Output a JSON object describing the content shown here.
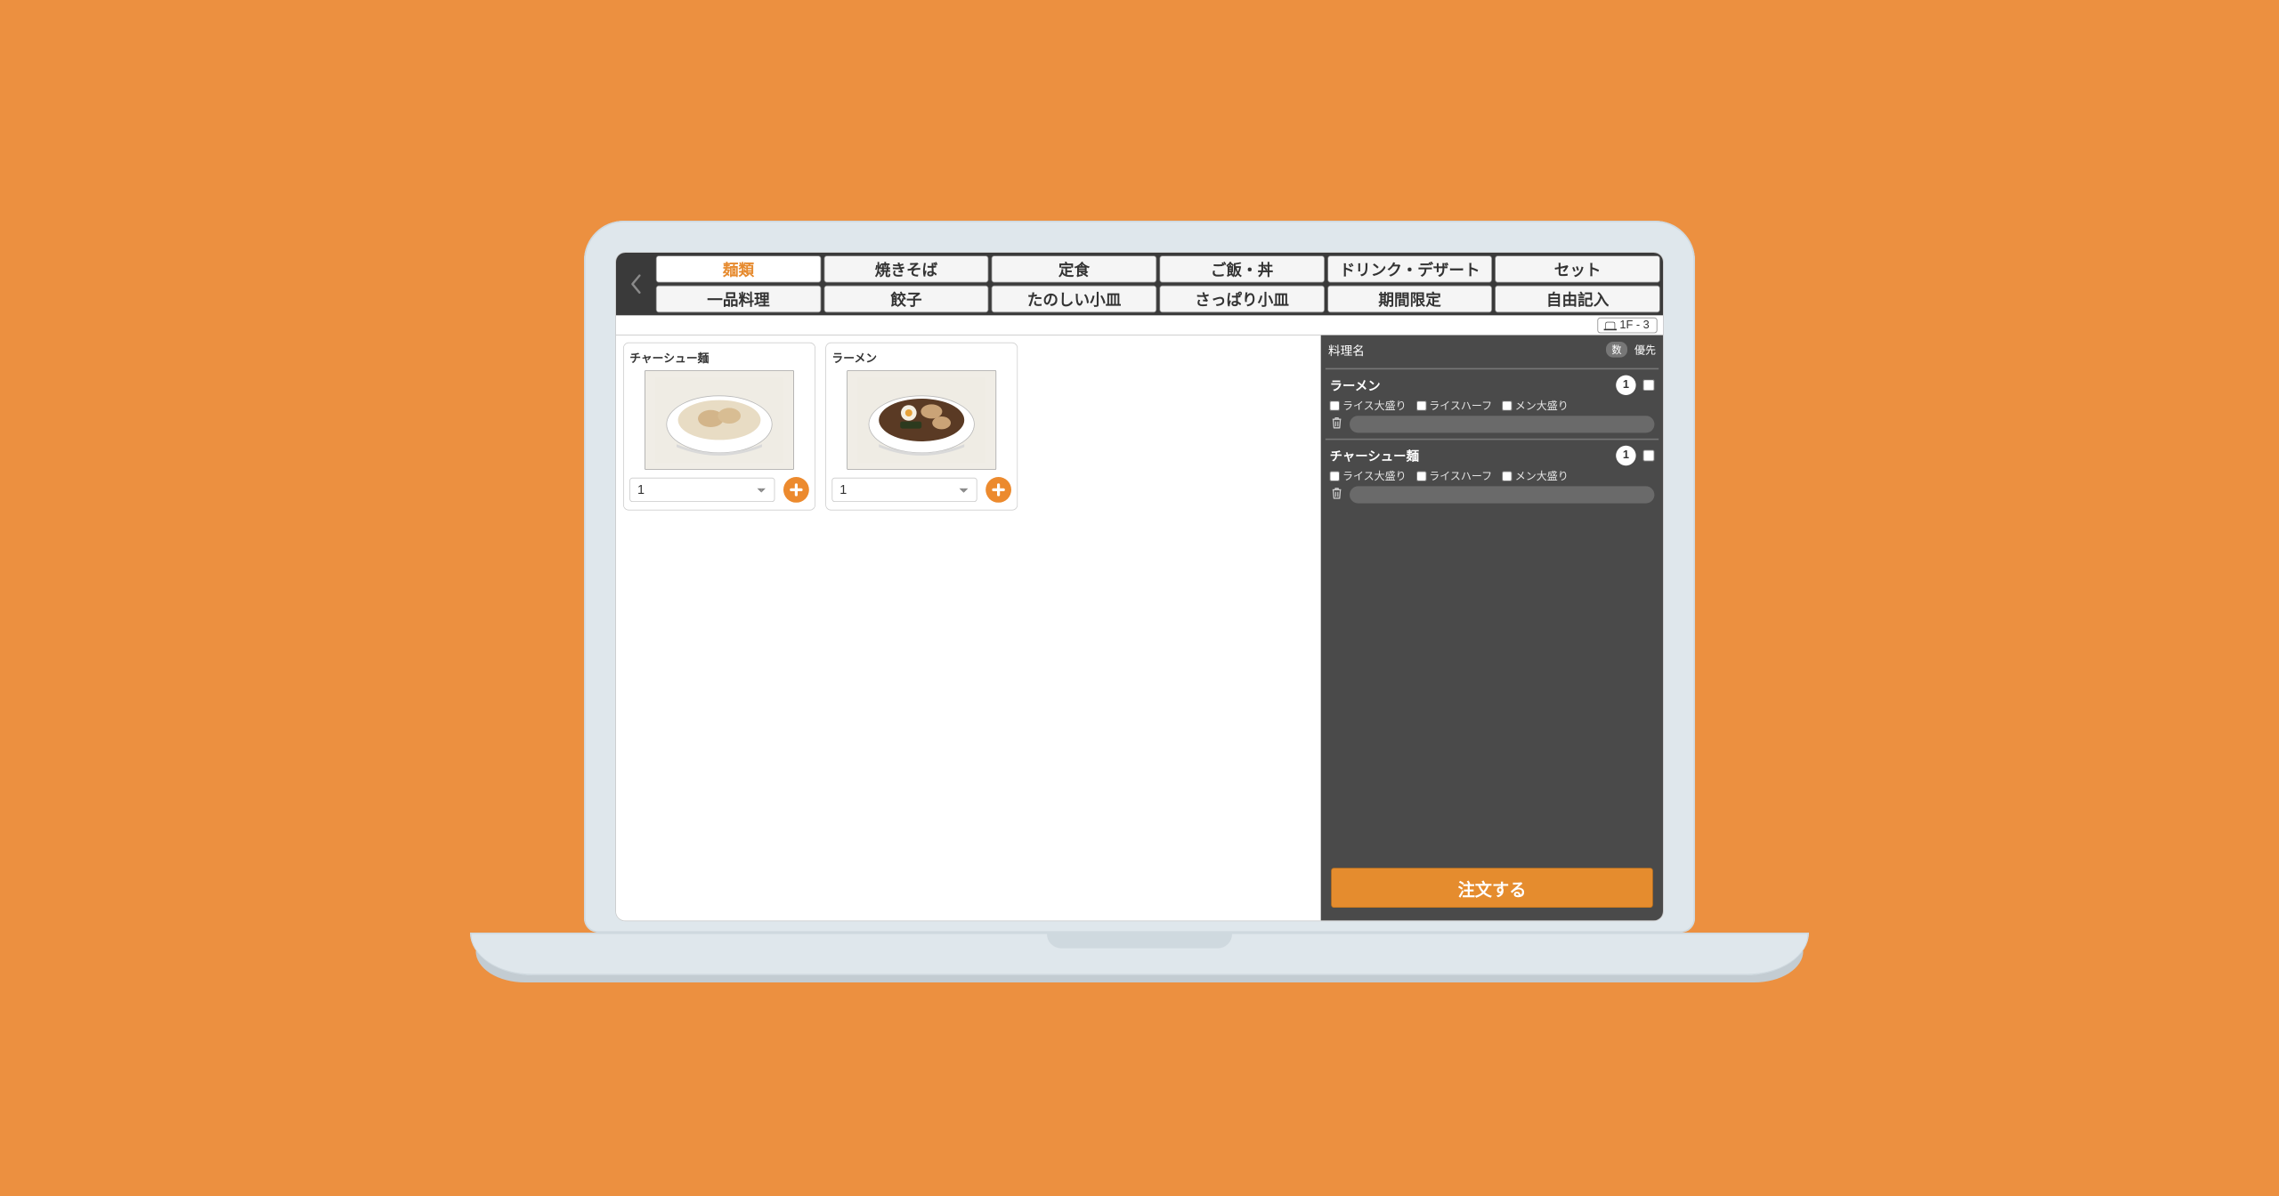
{
  "accent": "#ec8a2e",
  "table_label": "1F - 3",
  "tabs_row1": [
    "麺類",
    "焼きそば",
    "定食",
    "ご飯・丼",
    "ドリンク・デザート",
    "セット"
  ],
  "tabs_row2": [
    "一品料理",
    "餃子",
    "たのしい小皿",
    "さっぱり小皿",
    "期間限定",
    "自由記入"
  ],
  "active_tab": "麺類",
  "menu_items": [
    {
      "name": "チャーシュー麺",
      "qty": "1"
    },
    {
      "name": "ラーメン",
      "qty": "1"
    }
  ],
  "order_header": {
    "name_col": "料理名",
    "qty_col": "数",
    "priority_col": "優先"
  },
  "order_options": [
    "ライス大盛り",
    "ライスハーフ",
    "メン大盛り"
  ],
  "order_items": [
    {
      "name": "ラーメン",
      "qty": "1"
    },
    {
      "name": "チャーシュー麺",
      "qty": "1"
    }
  ],
  "order_button": "注文する"
}
